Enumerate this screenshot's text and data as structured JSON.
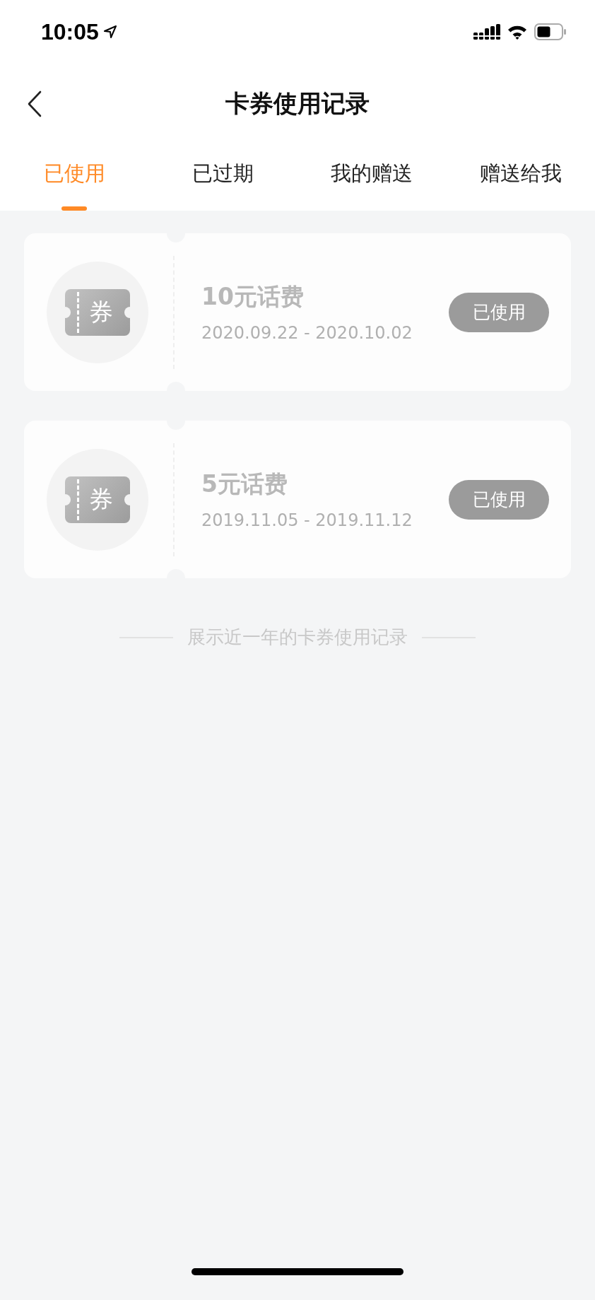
{
  "status_bar": {
    "time": "10:05"
  },
  "nav": {
    "title": "卡券使用记录"
  },
  "tabs": [
    {
      "label": "已使用",
      "selected": true
    },
    {
      "label": "已过期",
      "selected": false
    },
    {
      "label": "我的赠送",
      "selected": false
    },
    {
      "label": "赠送给我",
      "selected": false
    }
  ],
  "coupons": [
    {
      "icon_label": "券",
      "title": "10元话费",
      "period": "2020.09.22 - 2020.10.02",
      "status": "已使用"
    },
    {
      "icon_label": "券",
      "title": "5元话费",
      "period": "2019.11.05 - 2019.11.12",
      "status": "已使用"
    }
  ],
  "footer_note": "展示近一年的卡券使用记录"
}
